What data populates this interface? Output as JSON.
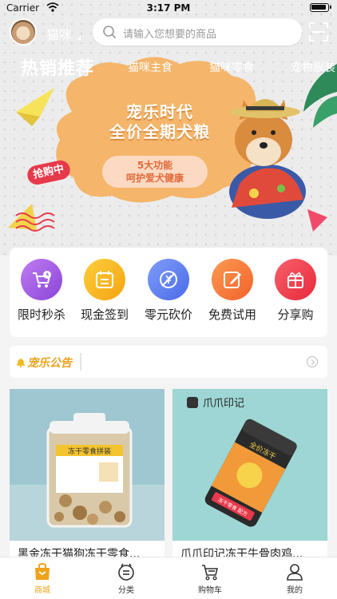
{
  "status_bar": {
    "carrier": "Carrier",
    "time": "3:17 PM"
  },
  "header": {
    "username": "猫咪",
    "search_placeholder": "请输入您想要的商品"
  },
  "tabs": [
    {
      "label": "热销推荐"
    },
    {
      "label": "猫咪主食"
    },
    {
      "label": "猫咪零食"
    },
    {
      "label": "宠物服装"
    }
  ],
  "banner": {
    "title_line1": "宠乐时代",
    "title_line2": "全价全期犬粮",
    "pill_line1": "5大功能",
    "pill_line2": "呵护爱犬健康",
    "tag": "抢购中"
  },
  "quick_menu": [
    {
      "label": "限时秒杀",
      "icon": "cart-clock-icon",
      "color": "#a55de6"
    },
    {
      "label": "现金签到",
      "icon": "calendar-icon",
      "color": "#f7b21c"
    },
    {
      "label": "零元砍价",
      "icon": "slash-tag-icon",
      "color": "#5b7ff2"
    },
    {
      "label": "免费试用",
      "icon": "edit-icon",
      "color": "#f67a3a"
    },
    {
      "label": "分享购",
      "icon": "gift-icon",
      "color": "#f0424f"
    }
  ],
  "notice": {
    "title": "宠乐公告"
  },
  "products": [
    {
      "name": "黑金冻干猫狗冻干零食..."
    },
    {
      "name": "爪爪印记冻干牛骨肉鸡..."
    }
  ],
  "product_art": {
    "jar_label": "冻干零食拼装",
    "brand_logo": "爪爪印记",
    "can_label": "全价冻干",
    "can_badge": "冻干零食 配方"
  },
  "tab_bar": [
    {
      "label": "商城",
      "icon": "shop-bag-icon",
      "active": true
    },
    {
      "label": "分类",
      "icon": "category-face-icon",
      "active": false
    },
    {
      "label": "购物车",
      "icon": "cart-icon",
      "active": false
    },
    {
      "label": "我的",
      "icon": "person-icon",
      "active": false
    }
  ],
  "colors": {
    "accent": "#f0a21a",
    "promo_red": "#e8394b",
    "notice_title": "#e8a11b"
  }
}
